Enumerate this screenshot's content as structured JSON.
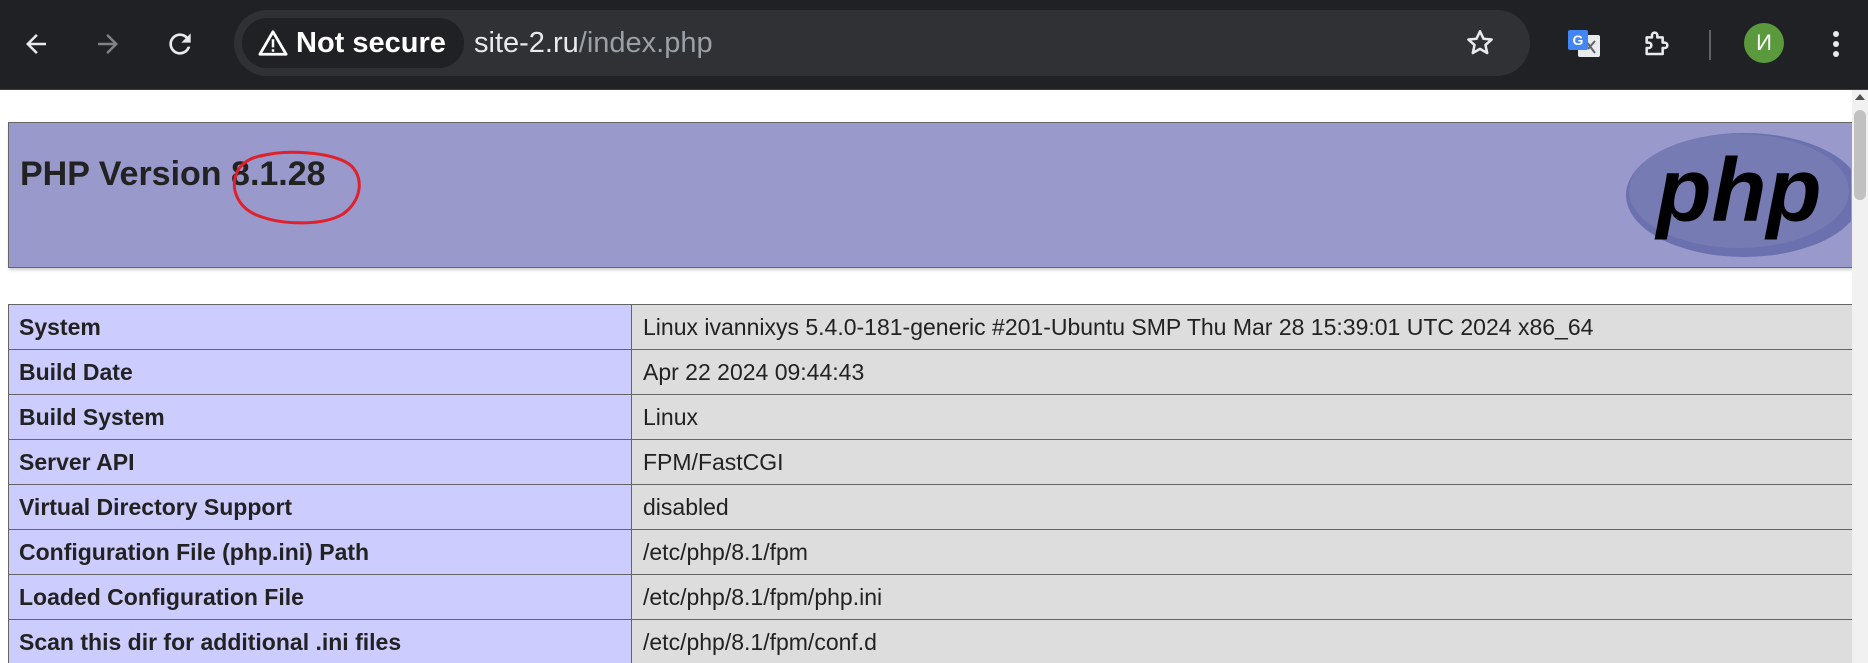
{
  "browser": {
    "back_icon": "arrow-left-icon",
    "forward_icon": "arrow-right-icon",
    "reload_icon": "reload-icon",
    "security_label": "Not secure",
    "security_icon": "warning-triangle-icon",
    "url_host": "site-2.ru",
    "url_path": "/index.php",
    "bookmark_icon": "star-icon",
    "translate_icon": "google-translate-icon",
    "extensions_icon": "puzzle-icon",
    "profile_initial": "И",
    "profile_color": "#5b9a3c",
    "menu_icon": "kebab-menu-icon"
  },
  "header": {
    "title_prefix": "PHP Version ",
    "version": "8.1.28",
    "header_bg": "#9999cc",
    "logo_text": "php",
    "annotation_color": "#e0202a"
  },
  "info_rows": [
    {
      "key": "System",
      "value": "Linux ivannixys 5.4.0-181-generic #201-Ubuntu SMP Thu Mar 28 15:39:01 UTC 2024 x86_64"
    },
    {
      "key": "Build Date",
      "value": "Apr 22 2024 09:44:43"
    },
    {
      "key": "Build System",
      "value": "Linux"
    },
    {
      "key": "Server API",
      "value": "FPM/FastCGI"
    },
    {
      "key": "Virtual Directory Support",
      "value": "disabled"
    },
    {
      "key": "Configuration File (php.ini) Path",
      "value": "/etc/php/8.1/fpm"
    },
    {
      "key": "Loaded Configuration File",
      "value": "/etc/php/8.1/fpm/php.ini"
    },
    {
      "key": "Scan this dir for additional .ini files",
      "value": "/etc/php/8.1/fpm/conf.d"
    }
  ],
  "colors": {
    "key_cell": "#ccccff",
    "value_cell": "#dddddd",
    "toolbar": "#202124"
  }
}
